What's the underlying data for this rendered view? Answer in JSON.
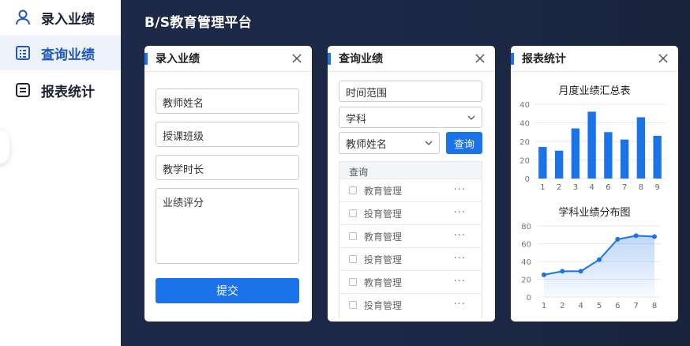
{
  "sidebar": {
    "items": [
      {
        "label": "录入业绩",
        "icon": "user-icon",
        "active": false
      },
      {
        "label": "查询业绩",
        "icon": "table-doc-icon",
        "active": true
      },
      {
        "label": "报表统计",
        "icon": "report-icon",
        "active": false
      }
    ]
  },
  "app": {
    "title": "B/S教育管理平台"
  },
  "entry_card": {
    "title": "录入业绩",
    "fields": {
      "teacher": "教师姓名",
      "class": "授课班级",
      "hours": "教学时长",
      "score": "业绩评分"
    },
    "submit_label": "提交"
  },
  "query_card": {
    "title": "查询业绩",
    "time_range": "时间范围",
    "subject": "学科",
    "teacher": "教师姓名",
    "query_label": "查询",
    "table_header": "查询",
    "rows": [
      "教育管理",
      "投育管理",
      "教育管理",
      "投育管理",
      "教育管理",
      "投育管理"
    ],
    "row_more": "···"
  },
  "report_card": {
    "title": "报表统计"
  },
  "accent_color": "#1a73e8",
  "chart_data": [
    {
      "type": "bar",
      "title": "月度业绩汇总表",
      "categories": [
        "1",
        "2",
        "3",
        "4",
        "6",
        "7",
        "8",
        "9"
      ],
      "values": [
        17,
        15,
        27,
        36,
        25,
        21,
        33,
        23
      ],
      "ylim": [
        0,
        40
      ],
      "yticks": [
        "0",
        "20",
        "20",
        "40",
        "40"
      ],
      "grid": true
    },
    {
      "type": "area",
      "title": "学科业绩分布图",
      "categories": [
        "1",
        "2",
        "4",
        "5",
        "6",
        "7",
        "8"
      ],
      "values": [
        25,
        29,
        29,
        42,
        65,
        69,
        68
      ],
      "ylim": [
        0,
        80
      ],
      "yticks": [
        "0",
        "20",
        "40",
        "60",
        "80"
      ],
      "grid": true
    }
  ]
}
